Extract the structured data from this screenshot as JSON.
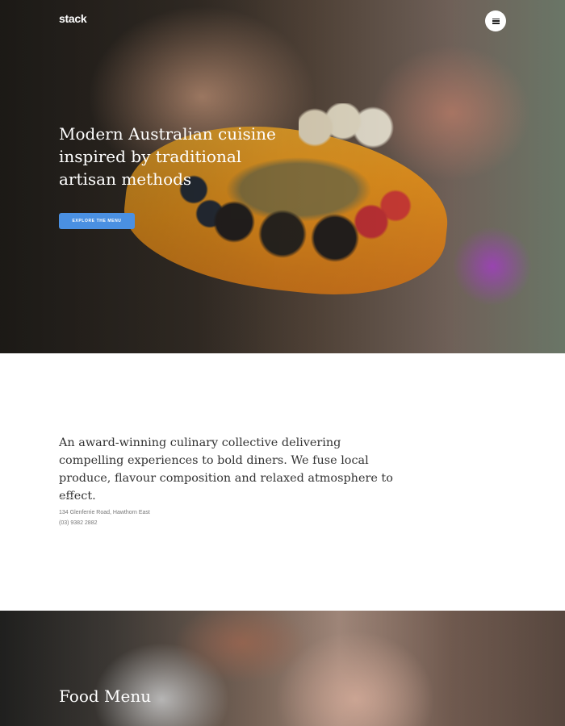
{
  "header": {
    "logo": "stack",
    "menu_icon": "hamburger-menu-icon"
  },
  "hero": {
    "title": "Modern Australian cuisine inspired by traditional artisan methods",
    "cta_label": "EXPLORE THE MENU",
    "accent_color": "#4a90e2"
  },
  "about": {
    "description": "An award-winning culinary collective delivering compelling experiences to bold diners. We fuse local produce, flavour composition and relaxed atmosphere to effect.",
    "address": "134 Glenferrie Road, Hawthorn East",
    "phone": "(03) 9382 2882"
  },
  "food_menu": {
    "title": "Food Menu"
  }
}
